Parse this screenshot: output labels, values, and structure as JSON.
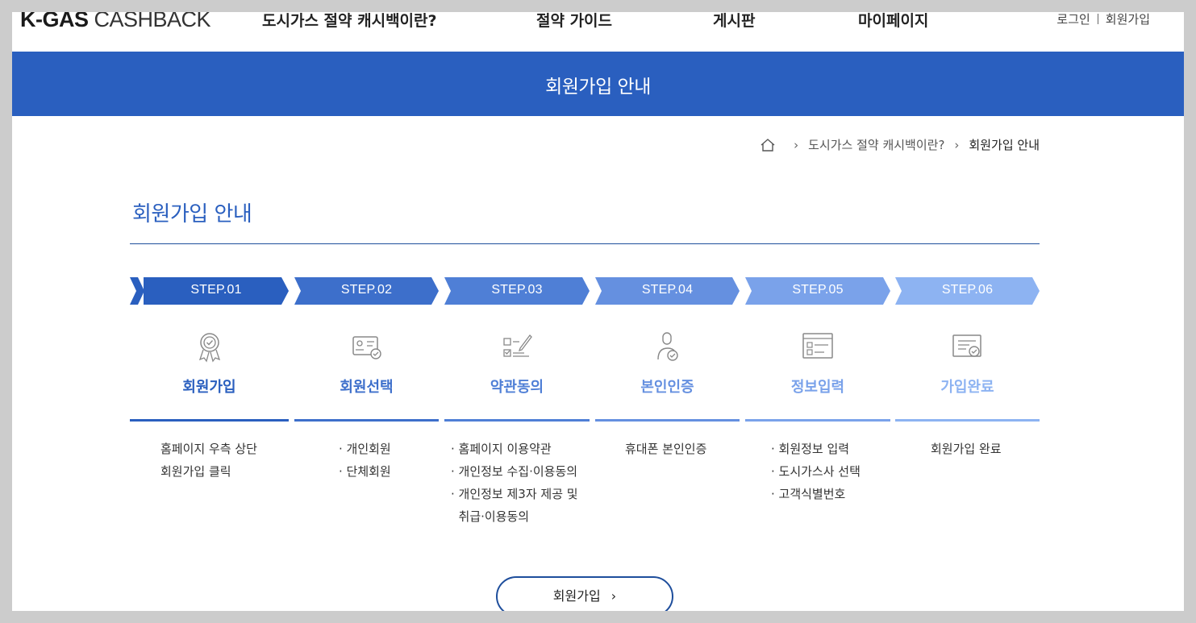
{
  "header": {
    "logo_bold": "K-GAS",
    "logo_light": "CASHBACK",
    "nav": [
      {
        "label": "도시가스 절약 캐시백이란?"
      },
      {
        "label": "절약 가이드"
      },
      {
        "label": "게시판"
      },
      {
        "label": "마이페이지"
      }
    ],
    "login_label": "로그인",
    "signup_label": "회원가입"
  },
  "banner": {
    "title": "회원가입 안내"
  },
  "breadcrumb": {
    "home_icon": "home-icon",
    "items": [
      "도시가스 절약 캐시백이란?",
      "회원가입 안내"
    ]
  },
  "section": {
    "title": "회원가입 안내"
  },
  "steps": [
    {
      "step": "STEP.01",
      "title": "회원가입",
      "icon": "award-badge-icon",
      "color": "#2a5fbf",
      "desc": [
        "홈페이지 우측 상단",
        "회원가입 클릭"
      ]
    },
    {
      "step": "STEP.02",
      "title": "회원선택",
      "icon": "member-card-icon",
      "color": "#3d6fcb",
      "desc": [
        "· 개인회원",
        "· 단체회원"
      ]
    },
    {
      "step": "STEP.03",
      "title": "약관동의",
      "icon": "checklist-pen-icon",
      "color": "#4f7fd6",
      "desc": [
        "· 홈페이지 이용약관",
        "· 개인정보 수집·이용동의",
        "· 개인정보 제3자 제공 및",
        "  취급·이용동의"
      ]
    },
    {
      "step": "STEP.04",
      "title": "본인인증",
      "icon": "user-verify-icon",
      "color": "#6590e0",
      "desc": [
        "휴대폰 본인인증"
      ]
    },
    {
      "step": "STEP.05",
      "title": "정보입력",
      "icon": "form-window-icon",
      "color": "#7aa2ea",
      "desc": [
        "· 회원정보 입력",
        "· 도시가스사 선택",
        "· 고객식별번호"
      ]
    },
    {
      "step": "STEP.06",
      "title": "가입완료",
      "icon": "certificate-icon",
      "color": "#8db3f2",
      "desc": [
        "회원가입 완료"
      ]
    }
  ],
  "join_button": {
    "label": "회원가입",
    "icon": "chevron-right-icon"
  }
}
